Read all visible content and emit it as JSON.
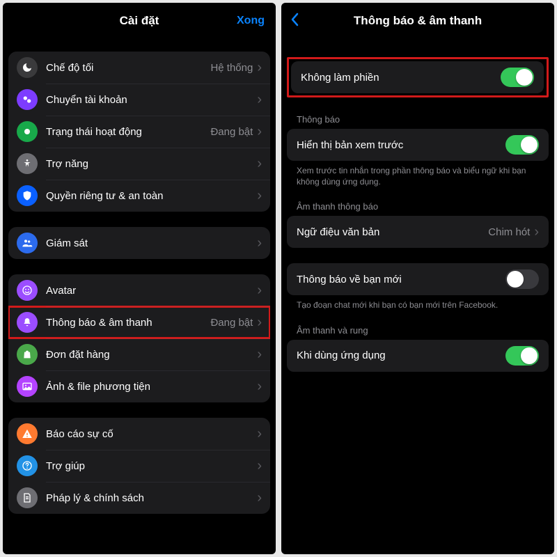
{
  "left": {
    "title": "Cài đặt",
    "done": "Xong",
    "groups": [
      [
        {
          "icon": "moon",
          "bg": "bg-dark",
          "label": "Chế độ tối",
          "value": "Hệ thống"
        },
        {
          "icon": "switch",
          "bg": "bg-purple",
          "label": "Chuyển tài khoản"
        },
        {
          "icon": "dot",
          "bg": "bg-green",
          "label": "Trạng thái hoạt động",
          "value": "Đang bật"
        },
        {
          "icon": "access",
          "bg": "bg-gray",
          "label": "Trợ năng"
        },
        {
          "icon": "shield",
          "bg": "bg-blue",
          "label": "Quyền riêng tư & an toàn"
        }
      ],
      [
        {
          "icon": "people",
          "bg": "bg-peoples",
          "label": "Giám sát"
        }
      ],
      [
        {
          "icon": "smiley",
          "bg": "bg-violet",
          "label": "Avatar"
        },
        {
          "icon": "bell",
          "bg": "bg-violet",
          "label": "Thông báo & âm thanh",
          "value": "Đang bật",
          "highlight": true
        },
        {
          "icon": "bag",
          "bg": "bg-shop",
          "label": "Đơn đặt hàng"
        },
        {
          "icon": "photo",
          "bg": "bg-media",
          "label": "Ảnh & file phương tiện"
        }
      ],
      [
        {
          "icon": "warn",
          "bg": "bg-orange",
          "label": "Báo cáo sự cố"
        },
        {
          "icon": "help",
          "bg": "bg-help",
          "label": "Trợ giúp"
        },
        {
          "icon": "doc",
          "bg": "bg-doc",
          "label": "Pháp lý & chính sách"
        }
      ]
    ]
  },
  "right": {
    "title": "Thông báo & âm thanh",
    "dnd": {
      "label": "Không làm phiền",
      "on": true,
      "highlight": true
    },
    "sections": [
      {
        "header": "Thông báo",
        "rows": [
          {
            "label": "Hiển thị bản xem trước",
            "toggle": true,
            "on": true
          }
        ],
        "footer": "Xem trước tin nhắn trong phần thông báo và biểu ngữ khi bạn không dùng ứng dụng."
      },
      {
        "header": "Âm thanh thông báo",
        "rows": [
          {
            "label": "Ngữ điệu văn bản",
            "value": "Chim hót",
            "chevron": true
          }
        ]
      },
      {
        "rows": [
          {
            "label": "Thông báo về bạn mới",
            "toggle": true,
            "on": false
          }
        ],
        "footer": "Tạo đoạn chat mới khi bạn có bạn mới trên Facebook."
      },
      {
        "header": "Âm thanh và rung",
        "rows": [
          {
            "label": "Khi dùng ứng dụng",
            "toggle": true,
            "on": true
          }
        ]
      }
    ]
  }
}
